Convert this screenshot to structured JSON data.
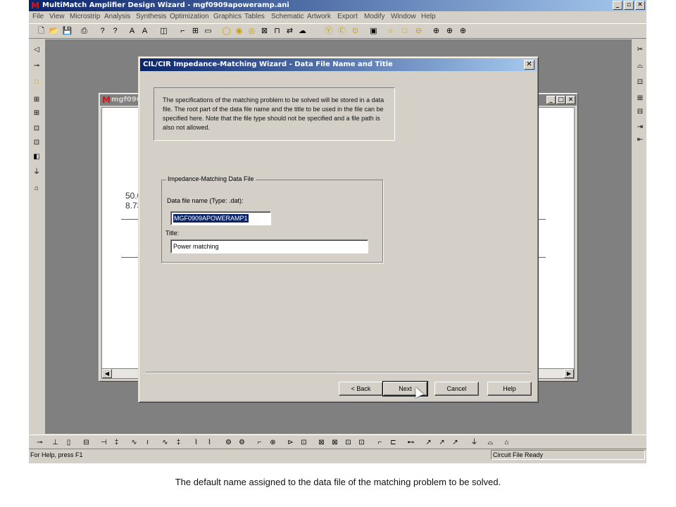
{
  "app": {
    "logo": "M",
    "title": "MultiMatch Amplifier Design Wizard - mgf0909apoweramp.ani",
    "window_buttons": [
      "_",
      "̅□",
      "✕"
    ]
  },
  "menu": [
    "File",
    "View",
    "Microstrip",
    "Analysis",
    "Synthesis",
    "Optimization",
    "Graphics",
    "Tables",
    "Schematic",
    "Artwork",
    "Export",
    "Modify",
    "Window",
    "Help"
  ],
  "toolbar_icons": [
    "new-icon",
    "open-icon",
    "save-icon",
    "print-icon",
    "help-icon",
    "context-help-icon",
    "font-up-icon",
    "font-down-icon",
    "expand-icon",
    "wire-icon",
    "component-icon",
    "text-icon",
    "circle-yellow-icon",
    "zoom-icon",
    "target-icon",
    "grid-icon",
    "box-icon",
    "swap-icon",
    "cloud-icon",
    "yellow-y-icon",
    "yellow-c-icon",
    "yellow-dot-icon",
    "frame-icon",
    "circle-icon",
    "square-icon",
    "minus-circle-icon",
    "amp1-icon",
    "amp2-icon",
    "amp3-icon"
  ],
  "child_window": {
    "title": "mgf090",
    "canvas_lines": [
      "50.0",
      "8.73"
    ]
  },
  "dialog": {
    "title": "CIL/CIR Impedance-Matching Wizard - Data File Name and Title",
    "close": "✕",
    "info": "The specifications of the matching problem to be solved will be stored in a data file. The root part of the data file name and the title to be used in the file can be specified here. Note that the file type should not be specified and a file path is also not allowed.",
    "group_label": "Impedance-Matching Data File",
    "file_label": "Data file name (Type: .dat):",
    "file_value": "MGF0909APOWERAMP1",
    "title_label": "Title:",
    "title_value": "Power matching",
    "buttons": {
      "back": "< Back",
      "next": "Next",
      "cancel": "Cancel",
      "help": "Help"
    }
  },
  "status": {
    "left": "For Help, press F1",
    "right": "Circuit File Ready"
  },
  "caption": "The default name assigned to the data file of the matching problem to be solved."
}
